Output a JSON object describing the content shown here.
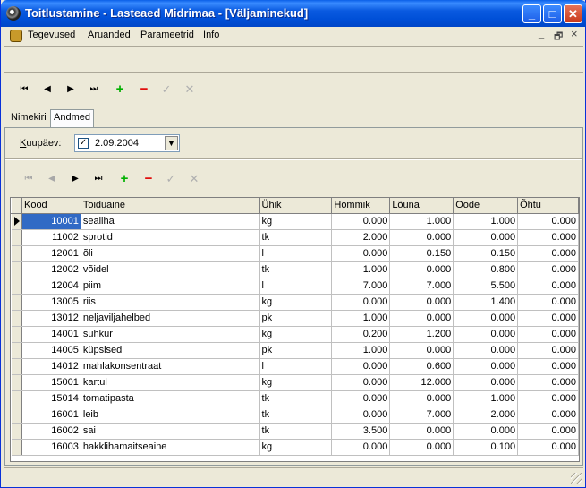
{
  "window": {
    "title": "Toitlustamine - Lasteaed Midrimaa - [Väljaminekud]",
    "controls": {
      "minimize": "_",
      "maximize": "□",
      "close": "✕"
    }
  },
  "menu": [
    {
      "prefix": "",
      "u": "T",
      "rest": "egevused"
    },
    {
      "prefix": "",
      "u": "A",
      "rest": "ruanded"
    },
    {
      "prefix": "",
      "u": "P",
      "rest": "arameetrid"
    },
    {
      "prefix": "",
      "u": "I",
      "rest": "nfo"
    }
  ],
  "mdi_controls": {
    "minimize": "_",
    "restore": "🗗",
    "close": "×"
  },
  "toolbar": {
    "first": "⏮",
    "prev": "◀",
    "next": "▶",
    "last": "⏭",
    "add": "+",
    "delete": "−",
    "post": "✓",
    "cancel": "✕"
  },
  "tabs": {
    "list": "Nimekiri",
    "data": "Andmed"
  },
  "date": {
    "label_u": "K",
    "label_rest": "uupäev:",
    "checked": "✓",
    "value": "2.09.2004",
    "dropdown": "▼"
  },
  "columns": [
    "Kood",
    "Toiduaine",
    "Ühik",
    "Hommik",
    "Lõuna",
    "Oode",
    "Õhtu"
  ],
  "rows": [
    [
      "10001",
      "sealiha",
      "kg",
      "0.000",
      "1.000",
      "1.000",
      "0.000"
    ],
    [
      "11002",
      "sprotid",
      "tk",
      "2.000",
      "0.000",
      "0.000",
      "0.000"
    ],
    [
      "12001",
      "õli",
      "l",
      "0.000",
      "0.150",
      "0.150",
      "0.000"
    ],
    [
      "12002",
      "võidel",
      "tk",
      "1.000",
      "0.000",
      "0.800",
      "0.000"
    ],
    [
      "12004",
      "piim",
      "l",
      "7.000",
      "7.000",
      "5.500",
      "0.000"
    ],
    [
      "13005",
      "riis",
      "kg",
      "0.000",
      "0.000",
      "1.400",
      "0.000"
    ],
    [
      "13012",
      "neljaviljahelbed",
      "pk",
      "1.000",
      "0.000",
      "0.000",
      "0.000"
    ],
    [
      "14001",
      "suhkur",
      "kg",
      "0.200",
      "1.200",
      "0.000",
      "0.000"
    ],
    [
      "14005",
      "küpsised",
      "pk",
      "1.000",
      "0.000",
      "0.000",
      "0.000"
    ],
    [
      "14012",
      "mahlakonsentraat",
      "l",
      "0.000",
      "0.600",
      "0.000",
      "0.000"
    ],
    [
      "15001",
      "kartul",
      "kg",
      "0.000",
      "12.000",
      "0.000",
      "0.000"
    ],
    [
      "15014",
      "tomatipasta",
      "tk",
      "0.000",
      "0.000",
      "1.000",
      "0.000"
    ],
    [
      "16001",
      "leib",
      "tk",
      "0.000",
      "7.000",
      "2.000",
      "0.000"
    ],
    [
      "16002",
      "sai",
      "tk",
      "3.500",
      "0.000",
      "0.000",
      "0.000"
    ],
    [
      "16003",
      "hakklihamaitseaine",
      "kg",
      "0.000",
      "0.000",
      "0.100",
      "0.000"
    ]
  ]
}
